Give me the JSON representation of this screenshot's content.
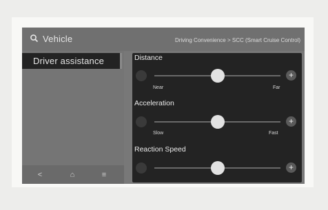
{
  "header": {
    "title": "Vehicle",
    "breadcrumb": "Driving Convenience > SCC (Smart Cruise Control)"
  },
  "sidebar": {
    "active_item": "Driver assistance"
  },
  "bottom_nav": [
    {
      "name": "back",
      "icon": "chevron-left-icon",
      "glyph": "<"
    },
    {
      "name": "home",
      "icon": "home-icon",
      "glyph": "⌂"
    },
    {
      "name": "menu",
      "icon": "menu-icon",
      "glyph": "≡"
    }
  ],
  "settings": [
    {
      "title": "Distance",
      "min_label": "Near",
      "max_label": "Far",
      "value_fraction": 0.5
    },
    {
      "title": "Acceleration",
      "min_label": "Slow",
      "max_label": "Fast",
      "value_fraction": 0.5
    },
    {
      "title": "Reaction Speed",
      "min_label": "",
      "max_label": "",
      "value_fraction": 0.5
    }
  ],
  "plus_glyph": "+"
}
